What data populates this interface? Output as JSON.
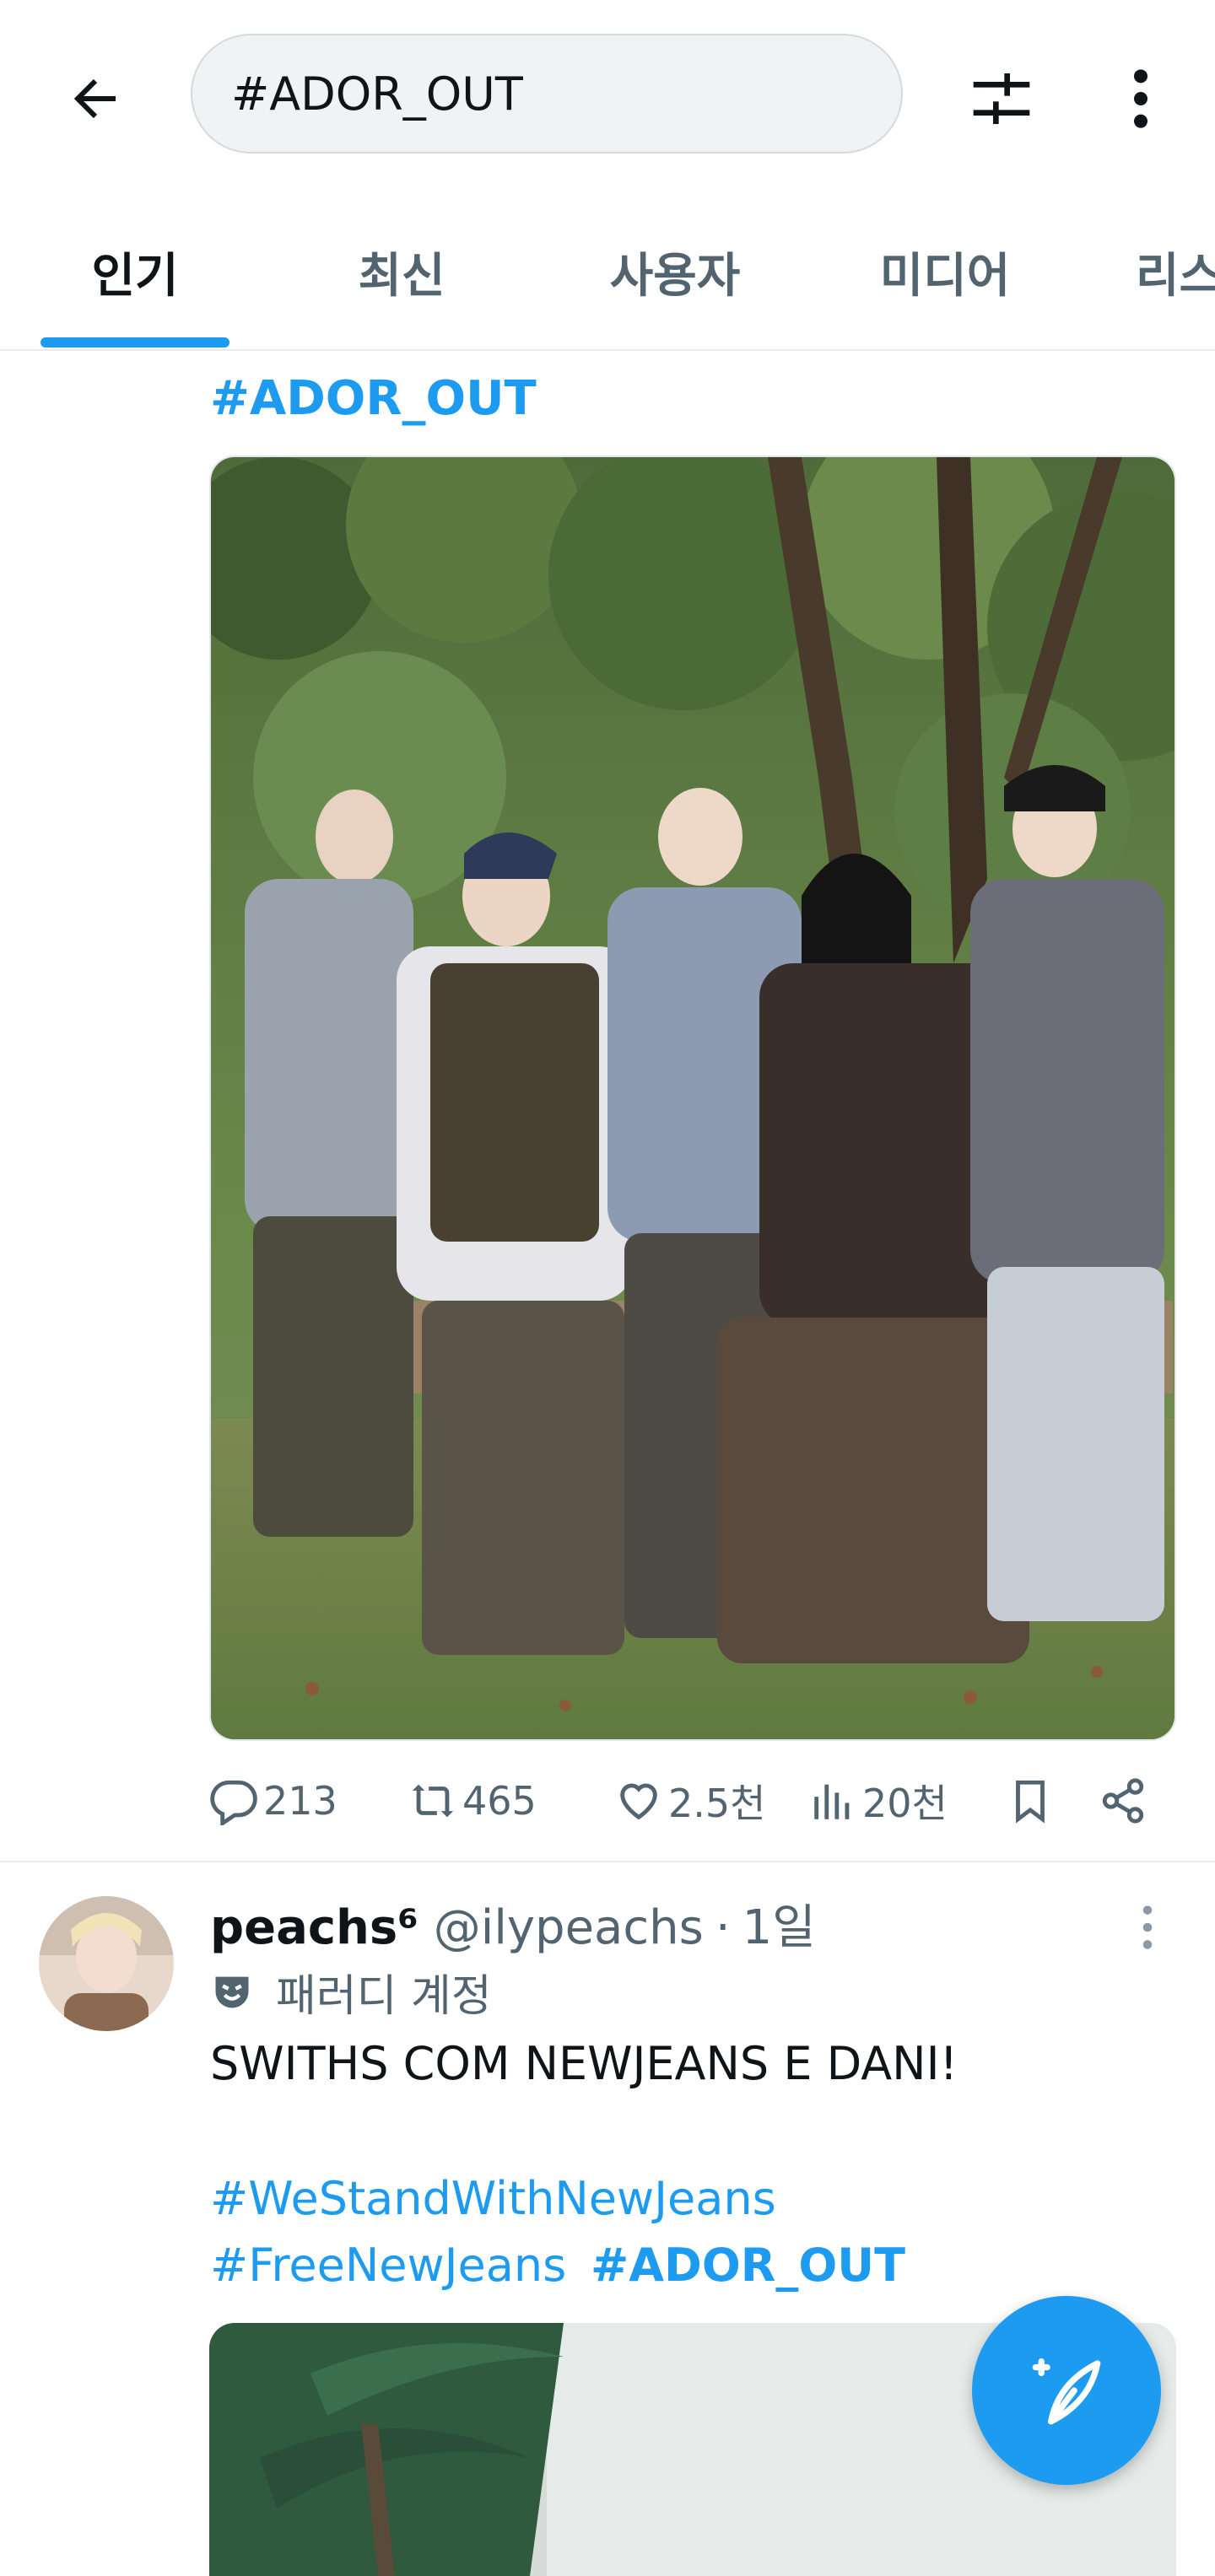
{
  "search": {
    "value": "#ADOR_OUT"
  },
  "tabs": [
    {
      "label": "인기"
    },
    {
      "label": "최신"
    },
    {
      "label": "사용자"
    },
    {
      "label": "미디어"
    },
    {
      "label": "리스"
    }
  ],
  "post1": {
    "hashtag": "#ADOR_OUT",
    "stats": {
      "replies": "213",
      "reposts": "465",
      "likes": "2.5천",
      "views": "20천"
    }
  },
  "post2": {
    "name": "peachs⁶",
    "handle": "@ilypeachs",
    "dot": "·",
    "time": "1일",
    "label": "패러디 계정",
    "text": "SWITHS COM NEWJEANS E DANI!",
    "tags": [
      "#WeStandWithNewJeans",
      "#FreeNewJeans",
      "#ADOR_OUT"
    ]
  },
  "colors": {
    "accent": "#1d9bf0",
    "muted": "#536471",
    "text": "#0f1419"
  }
}
